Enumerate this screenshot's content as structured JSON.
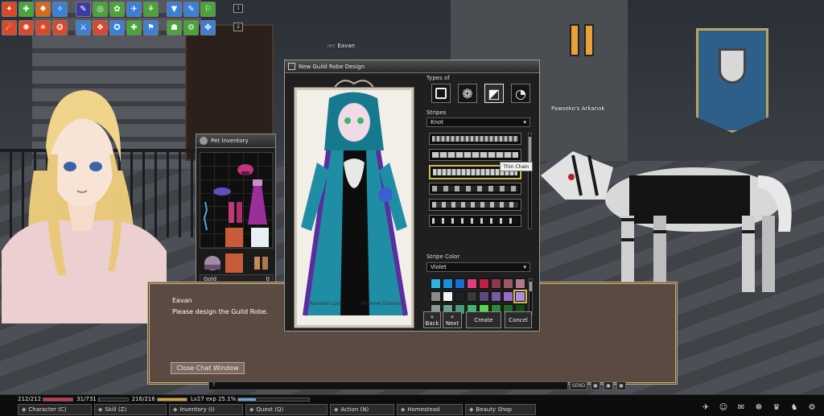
{
  "scene": {
    "npc_name": "Eavan",
    "npc_name_tag": "NPC",
    "player_name": "Pawseko's Arkanok"
  },
  "hotbar": {
    "row_numbers": [
      "1",
      "2"
    ],
    "row1": [
      {
        "icon": "skill-icon",
        "color": "#d9482b",
        "glyph": "✦"
      },
      {
        "icon": "skill-icon",
        "color": "#4aa43a",
        "glyph": "✚"
      },
      {
        "icon": "skill-icon",
        "color": "#d66a1e",
        "glyph": "✸"
      },
      {
        "icon": "skill-icon",
        "color": "#3b7fd6",
        "glyph": "✧"
      },
      {
        "icon": "skill-icon",
        "color": "#3c3aa3",
        "glyph": "✎"
      },
      {
        "icon": "skill-icon",
        "color": "#4aa43a",
        "glyph": "◎"
      },
      {
        "icon": "skill-icon",
        "color": "#4aa43a",
        "glyph": "✿"
      },
      {
        "icon": "skill-icon",
        "color": "#3b7fd6",
        "glyph": "✈"
      },
      {
        "icon": "skill-icon",
        "color": "#4aa43a",
        "glyph": "⚘"
      },
      {
        "icon": "skill-icon",
        "color": "#3b7fd6",
        "glyph": "▼"
      },
      {
        "icon": "skill-icon",
        "color": "#3b7fd6",
        "glyph": "✎"
      },
      {
        "icon": "skill-icon",
        "color": "#4aa43a",
        "glyph": "⚐"
      }
    ],
    "row2": [
      {
        "icon": "skill-icon",
        "color": "#d9482b",
        "glyph": "☄"
      },
      {
        "icon": "skill-icon",
        "color": "#d9482b",
        "glyph": "✺"
      },
      {
        "icon": "skill-icon",
        "color": "#d9482b",
        "glyph": "☀"
      },
      {
        "icon": "skill-icon",
        "color": "#d9482b",
        "glyph": "❂"
      },
      {
        "icon": "skill-icon",
        "color": "#3b7fd6",
        "glyph": "⚔"
      },
      {
        "icon": "skill-icon",
        "color": "#d9482b",
        "glyph": "❖"
      },
      {
        "icon": "skill-icon",
        "color": "#3b7fd6",
        "glyph": "✪"
      },
      {
        "icon": "skill-icon",
        "color": "#4aa43a",
        "glyph": "✚"
      },
      {
        "icon": "skill-icon",
        "color": "#3b7fd6",
        "glyph": "⚑"
      },
      {
        "icon": "skill-icon",
        "color": "#4aa43a",
        "glyph": "☗"
      },
      {
        "icon": "skill-icon",
        "color": "#4aa43a",
        "glyph": "⚙"
      },
      {
        "icon": "skill-icon",
        "color": "#3b7fd6",
        "glyph": "✤"
      }
    ]
  },
  "pet_inventory": {
    "title": "Pet Inventory",
    "gold_label": "Gold",
    "gold_value": "0"
  },
  "robe_window": {
    "title": "New Guild Robe Design",
    "types_label": "Types of",
    "stripes_label": "Stripes",
    "stripe_selected": "Knot",
    "stripe_color_label": "Stripe Color",
    "color_selected": "Violet",
    "tooltip": "Thin Chain",
    "preview_left_label": "Random Look",
    "preview_right_label": "Remove Gimmick",
    "swatches": [
      "#2fb3e6",
      "#1e8fd6",
      "#1a6fd0",
      "#e43d7a",
      "#c02046",
      "#8a3a4c",
      "#9a5a66",
      "#b07a88",
      "#8c8c8c",
      "#f4f4f4",
      "#202020",
      "#3a3a3a",
      "#5c4a7a",
      "#7a5aa0",
      "#9c6ac8",
      "#b08ae0",
      "#8a9a90",
      "#6aa090",
      "#4a9a7a",
      "#3cb870",
      "#50d850",
      "#2e8a3a",
      "#1f6a2a",
      "#154a1c"
    ],
    "swatch_selected_index": 15,
    "buttons": {
      "back": "Back",
      "next": "Next",
      "create": "Create",
      "cancel": "Cancel"
    }
  },
  "dialogue": {
    "speaker": "Eavan",
    "text": "Please design the Guild Robe.",
    "close_button": "Close Chat Window"
  },
  "status": {
    "hp": "212/212",
    "mp": "31/731",
    "sp": "216/216",
    "exp": "Lv27 exp 25.1%",
    "hp_fill": 1.0,
    "mp_fill": 0.04,
    "sp_fill": 1.0,
    "exp_fill": 0.25
  },
  "menu": [
    {
      "label": "Character (C)",
      "icon": "character-icon"
    },
    {
      "label": "Skill (Z)",
      "icon": "skill-icon"
    },
    {
      "label": "Inventory (I)",
      "icon": "inventory-icon"
    },
    {
      "label": "Quest (Q)",
      "icon": "quest-icon"
    },
    {
      "label": "Action (N)",
      "icon": "action-icon"
    },
    {
      "label": "Homestead",
      "icon": "homestead-icon"
    },
    {
      "label": "Beauty Shop",
      "icon": "beauty-shop-icon"
    }
  ],
  "chat": {
    "input": "?",
    "send": "SEND"
  }
}
